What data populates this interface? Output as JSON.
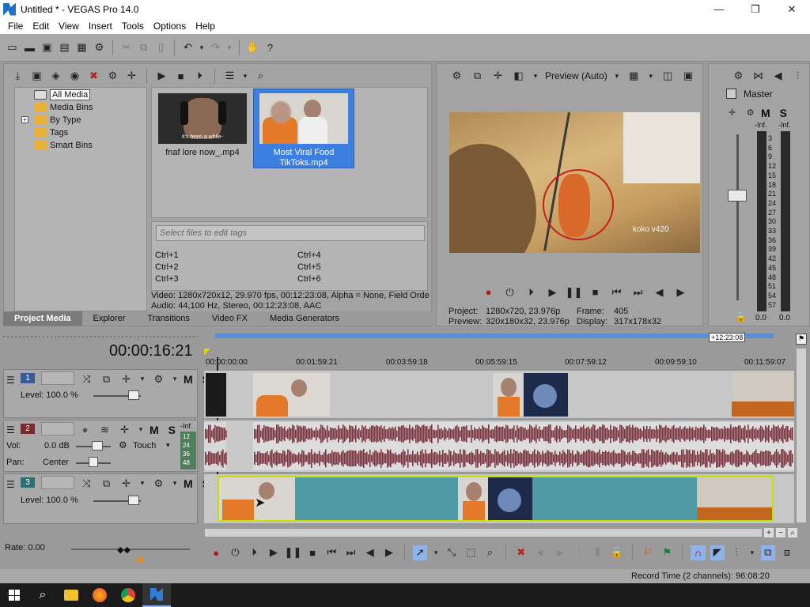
{
  "window": {
    "title": "Untitled * - VEGAS Pro 14.0"
  },
  "menu": [
    "File",
    "Edit",
    "View",
    "Insert",
    "Tools",
    "Options",
    "Help"
  ],
  "project_media": {
    "tree": [
      "All Media",
      "Media Bins",
      "By Type",
      "Tags",
      "Smart Bins"
    ],
    "files": [
      {
        "name": "fnaf lore now_.mp4",
        "caption": "it's been a while-",
        "selected": false
      },
      {
        "name": "Most Viral Food TikToks.mp4",
        "caption": "",
        "selected": true
      }
    ],
    "tag_placeholder": "Select files to edit tags",
    "shortcuts": [
      "Ctrl+1",
      "Ctrl+2",
      "Ctrl+3",
      "Ctrl+4",
      "Ctrl+5",
      "Ctrl+6"
    ],
    "info_video": "Video: 1280x720x12, 29.970 fps, 00:12:23:08, Alpha = None, Field Orde",
    "info_audio": "Audio: 44,100 Hz, Stereo, 00:12:23:08, AAC",
    "tabs": [
      "Project Media",
      "Explorer",
      "Transitions",
      "Video FX",
      "Media Generators"
    ],
    "active_tab": "Project Media"
  },
  "preview": {
    "mode": "Preview (Auto)",
    "watermark": "koko v420",
    "project_label": "Project:",
    "project_value": "1280x720, 23.976p",
    "preview_label": "Preview:",
    "preview_value": "320x180x32, 23.976p",
    "frame_label": "Frame:",
    "frame_value": "405",
    "display_label": "Display:",
    "display_value": "317x178x32"
  },
  "master": {
    "label": "Master",
    "mute": "M",
    "solo": "S",
    "left_top": "-Inf.",
    "right_top": "-Inf.",
    "scale": [
      "3",
      "6",
      "9",
      "12",
      "15",
      "18",
      "21",
      "24",
      "27",
      "30",
      "33",
      "36",
      "39",
      "42",
      "45",
      "48",
      "51",
      "54",
      "57"
    ],
    "left_bottom": "0.0",
    "right_bottom": "0.0"
  },
  "timeline": {
    "timecode": "00:00:16:21",
    "region_end": "+12:23:08",
    "ruler": [
      "00:00:00:00",
      "00:01:59:21",
      "00:03:59:18",
      "00:05:59:15",
      "00:07:59:12",
      "00:09:59:10",
      "00:11:59:07"
    ],
    "tracks": [
      {
        "number": "1",
        "type": "video",
        "level_label": "Level: 100.0 %",
        "mute": "M",
        "solo": "S"
      },
      {
        "number": "2",
        "type": "audio",
        "vol_label": "Vol:",
        "vol_value": "0.0 dB",
        "pan_label": "Pan:",
        "pan_value": "Center",
        "mode": "Touch",
        "mute": "M",
        "solo": "S",
        "meter_top": "-Inf.",
        "meter_scale": [
          "12",
          "24",
          "36",
          "48"
        ]
      },
      {
        "number": "3",
        "type": "video",
        "level_label": "Level: 100.0 %",
        "mute": "M",
        "solo": "S"
      }
    ],
    "rate_label": "Rate: 0.00"
  },
  "status": {
    "record_time": "Record Time (2 channels): 96:08:20"
  },
  "colors": {
    "accent_blue": "#1e6fd0",
    "selection": "#3d7fe0",
    "track1": "#3a5a9a",
    "track2": "#7a2a2a",
    "track3": "#2e6f74",
    "waveform": "#8a2e3d",
    "track3_fill": "#4e9aa5"
  }
}
